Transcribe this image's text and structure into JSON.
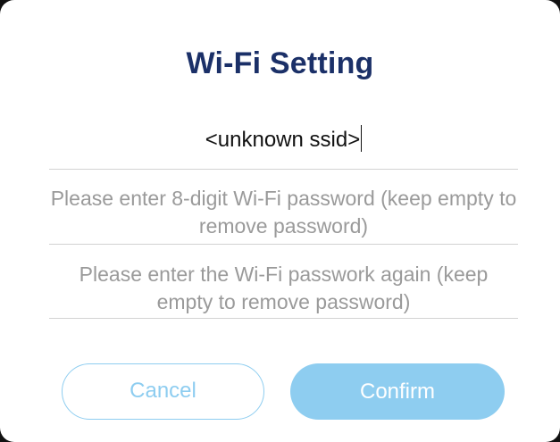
{
  "dialog": {
    "title": "Wi-Fi Setting",
    "ssid_value": "<unknown ssid>",
    "password_placeholder": "Please enter 8-digit Wi-Fi password (keep empty to remove password)",
    "confirm_password_placeholder": "Please enter the Wi-Fi passwork again (keep empty to remove password)",
    "cancel_label": "Cancel",
    "confirm_label": "Confirm"
  },
  "colors": {
    "title": "#1b3068",
    "accent": "#8ecdf0",
    "placeholder": "#9a9a9a",
    "divider": "#d2d2d2"
  }
}
